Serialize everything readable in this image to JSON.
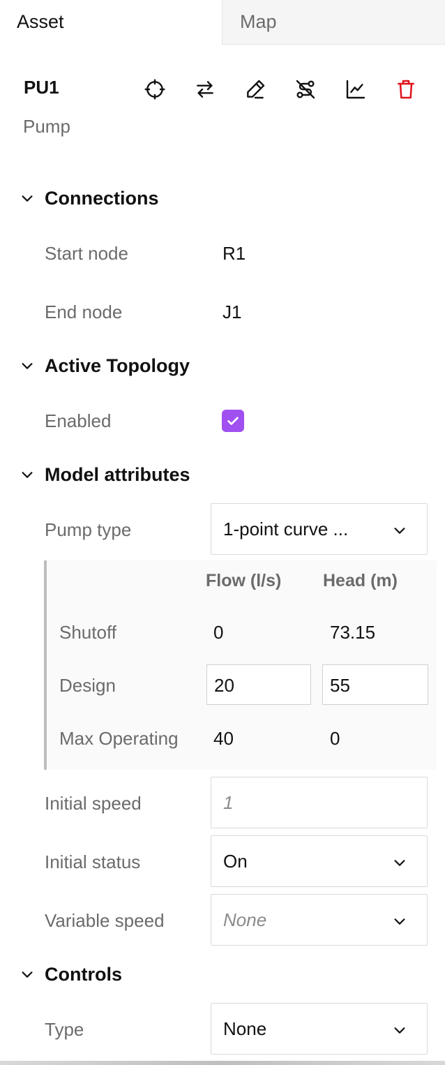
{
  "tabs": {
    "asset": "Asset",
    "map": "Map"
  },
  "asset": {
    "id": "PU1",
    "type": "Pump"
  },
  "toolbar": {
    "icons": [
      "crosshair-icon",
      "swap-icon",
      "pencil-icon",
      "route-off-icon",
      "chart-line-icon",
      "trash-icon"
    ],
    "delete_color": "#e0141e"
  },
  "sections": {
    "connections": {
      "title": "Connections",
      "start_node_label": "Start node",
      "start_node_value": "R1",
      "end_node_label": "End node",
      "end_node_value": "J1"
    },
    "active_topology": {
      "title": "Active Topology",
      "enabled_label": "Enabled",
      "enabled": true,
      "accent_color": "#a04ff0"
    },
    "model_attributes": {
      "title": "Model attributes",
      "pump_type_label": "Pump type",
      "pump_type_value": "1-point curve ...",
      "curve": {
        "col_flow": "Flow (l/s)",
        "col_head": "Head (m)",
        "shutoff_label": "Shutoff",
        "shutoff_flow": "0",
        "shutoff_head": "73.15",
        "design_label": "Design",
        "design_flow": "20",
        "design_head": "55",
        "max_label": "Max Operating",
        "max_flow": "40",
        "max_head": "0"
      },
      "initial_speed_label": "Initial speed",
      "initial_speed_placeholder": "1",
      "initial_status_label": "Initial status",
      "initial_status_value": "On",
      "variable_speed_label": "Variable speed",
      "variable_speed_value": "None"
    },
    "controls": {
      "title": "Controls",
      "type_label": "Type",
      "type_value": "None"
    }
  }
}
